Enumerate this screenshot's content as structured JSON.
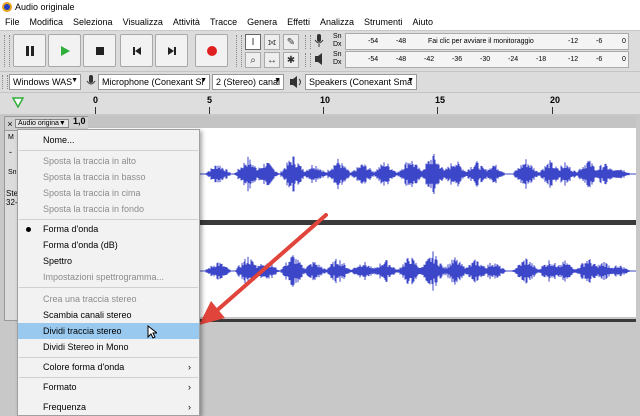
{
  "window": {
    "title": "Audio originale"
  },
  "menubar": {
    "items": [
      "File",
      "Modifica",
      "Seleziona",
      "Visualizza",
      "Attività",
      "Tracce",
      "Genera",
      "Effetti",
      "Analizza",
      "Strumenti",
      "Aiuto"
    ]
  },
  "meters": {
    "playback_label": "Sn\nDx",
    "record_label": "Sn\nDx",
    "record_scale": [
      "-54",
      "-48",
      "-12",
      "-6",
      "0"
    ],
    "record_prompt": "Fai clic per avviare il monitoraggio",
    "play_scale": [
      "-54",
      "-48",
      "-42",
      "-36",
      "-30",
      "-24",
      "-18",
      "-12",
      "-6",
      "0"
    ]
  },
  "device_bar": {
    "host": "Windows WAS",
    "recording_device": "Microphone (Conexant Sr",
    "channels": "2 (Stereo) canal",
    "playback_device": "Speakers (Conexant Sma"
  },
  "timeline": {
    "ticks": [
      "0",
      "5",
      "10",
      "15",
      "20"
    ]
  },
  "track": {
    "name": "Audio origina",
    "gain_readout": "1,0",
    "mute_short": "M",
    "info_line1": "Ste",
    "info_line2": "32-",
    "scale_short": "Sn",
    "dash": "-"
  },
  "context_menu": {
    "items": [
      {
        "label": "Nome...",
        "state": "enabled"
      },
      {
        "label": "Sposta la traccia in alto",
        "state": "disabled"
      },
      {
        "label": "Sposta la traccia in basso",
        "state": "disabled"
      },
      {
        "label": "Sposta la traccia in cima",
        "state": "disabled"
      },
      {
        "label": "Sposta la traccia in fondo",
        "state": "disabled"
      },
      {
        "label": "Forma d'onda",
        "state": "checked"
      },
      {
        "label": "Forma d'onda (dB)",
        "state": "enabled"
      },
      {
        "label": "Spettro",
        "state": "enabled"
      },
      {
        "label": "Impostazioni spettrogramma...",
        "state": "disabled"
      },
      {
        "label": "Crea una traccia stereo",
        "state": "disabled"
      },
      {
        "label": "Scambia canali stereo",
        "state": "enabled"
      },
      {
        "label": "Dividi traccia stereo",
        "state": "highlighted"
      },
      {
        "label": "Dividi Stereo in Mono",
        "state": "enabled"
      },
      {
        "label": "Colore forma d'onda",
        "state": "submenu"
      },
      {
        "label": "Formato",
        "state": "submenu"
      },
      {
        "label": "Frequenza",
        "state": "submenu"
      }
    ]
  },
  "colors": {
    "waveform": "#3c46c8",
    "highlight": "#99c9ef",
    "arrow": "#e0443a",
    "record": "#e02020",
    "play": "#2fae3a"
  }
}
